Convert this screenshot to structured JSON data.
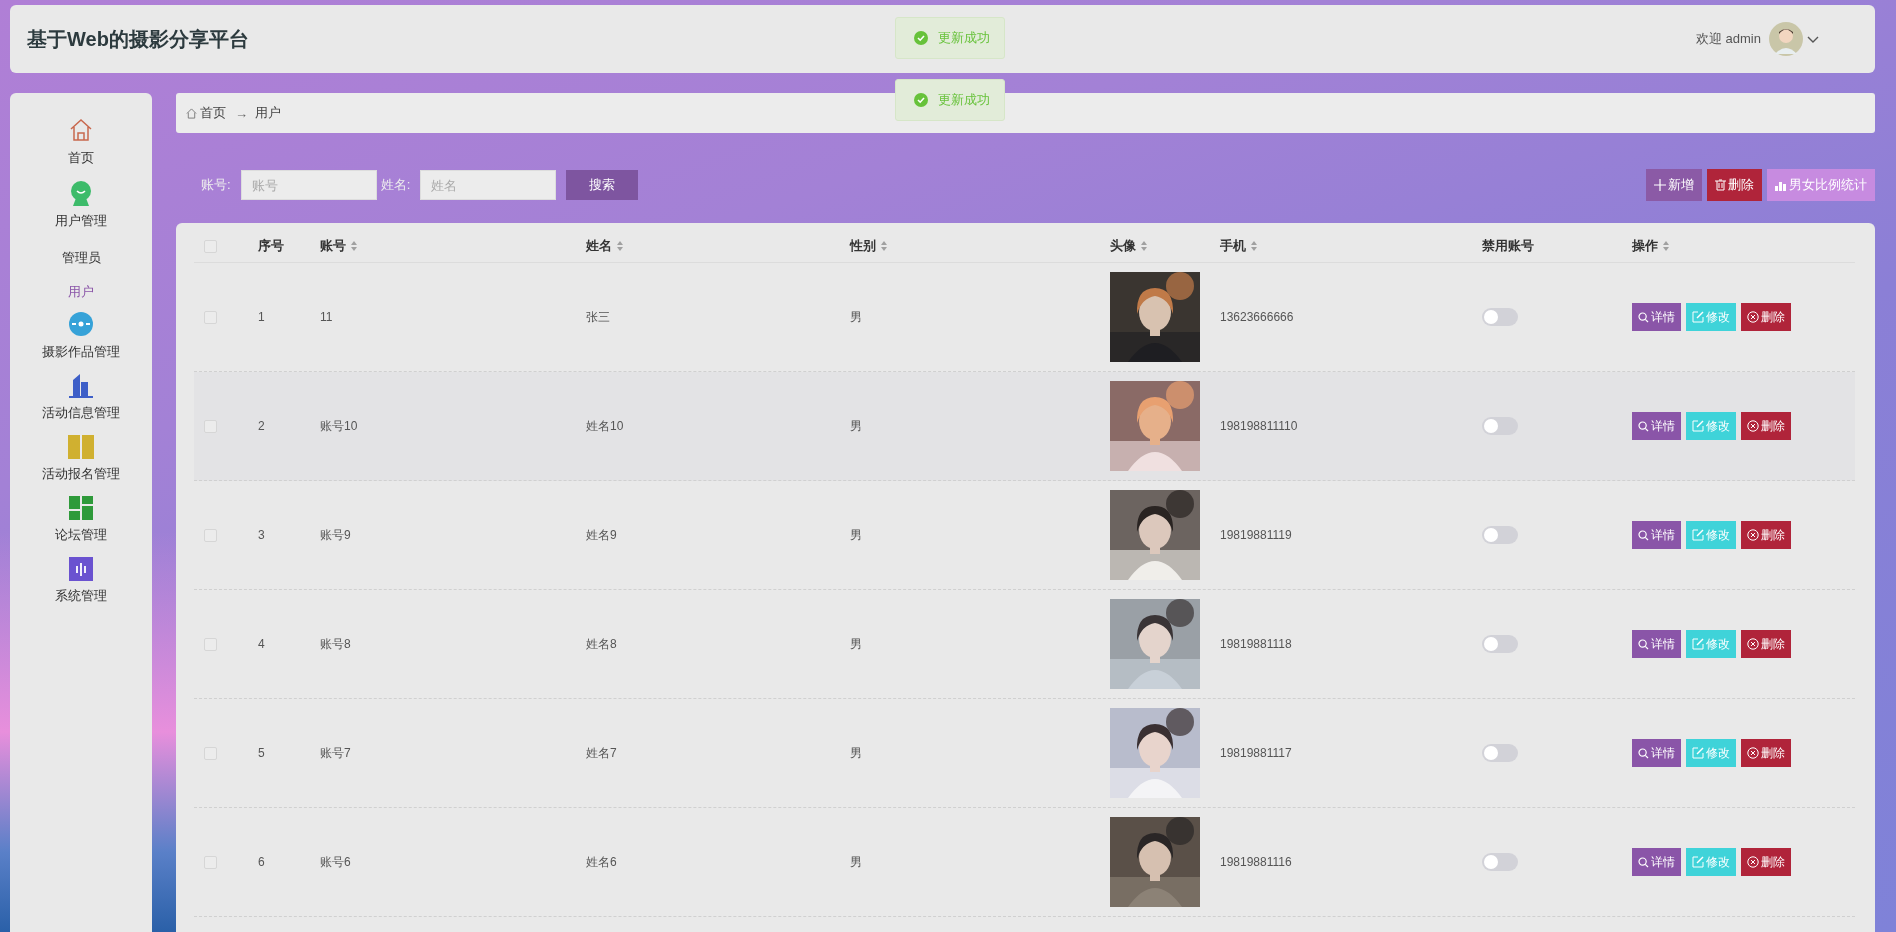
{
  "header": {
    "title": "基于Web的摄影分享平台",
    "welcome": "欢迎 admin"
  },
  "toasts": [
    {
      "text": "更新成功"
    },
    {
      "text": "更新成功"
    }
  ],
  "sidebar": {
    "items": [
      {
        "label": "首页"
      },
      {
        "label": "用户管理",
        "children": [
          {
            "label": "管理员",
            "selected": false
          },
          {
            "label": "用户",
            "selected": true
          }
        ]
      },
      {
        "label": "摄影作品管理"
      },
      {
        "label": "活动信息管理"
      },
      {
        "label": "活动报名管理"
      },
      {
        "label": "论坛管理"
      },
      {
        "label": "系统管理"
      }
    ]
  },
  "breadcrumb": {
    "items": [
      "首页",
      "用户"
    ],
    "separator": "→"
  },
  "search": {
    "fields": [
      {
        "label": "账号:",
        "placeholder": "账号"
      },
      {
        "label": "姓名:",
        "placeholder": "姓名"
      }
    ],
    "button": "搜索"
  },
  "toolbar": [
    {
      "kind": "add",
      "label": "新增"
    },
    {
      "kind": "delete",
      "label": "删除"
    },
    {
      "kind": "chart",
      "label": "男女比例统计"
    }
  ],
  "table": {
    "all_checked": false,
    "columns": [
      {
        "label": "序号",
        "sortable": false
      },
      {
        "label": "账号",
        "sortable": true
      },
      {
        "label": "姓名",
        "sortable": true
      },
      {
        "label": "性别",
        "sortable": true
      },
      {
        "label": "头像",
        "sortable": true
      },
      {
        "label": "手机",
        "sortable": true
      },
      {
        "label": "禁用账号",
        "sortable": false
      },
      {
        "label": "操作",
        "sortable": true
      }
    ],
    "rows": [
      {
        "index": "1",
        "account": "11",
        "name": "张三",
        "gender": "男",
        "phone": "13623666666",
        "disabled": false,
        "checked": false,
        "actions": [
          {
            "kind": "detail",
            "label": "详情"
          },
          {
            "kind": "edit",
            "label": "修改"
          },
          {
            "kind": "delete",
            "label": "删除"
          }
        ]
      },
      {
        "index": "2",
        "account": "账号10",
        "name": "姓名10",
        "gender": "男",
        "phone": "198198811110",
        "disabled": false,
        "checked": false,
        "actions": [
          {
            "kind": "detail",
            "label": "详情"
          },
          {
            "kind": "edit",
            "label": "修改"
          },
          {
            "kind": "delete",
            "label": "删除"
          }
        ]
      },
      {
        "index": "3",
        "account": "账号9",
        "name": "姓名9",
        "gender": "男",
        "phone": "19819881119",
        "disabled": false,
        "checked": false,
        "actions": [
          {
            "kind": "detail",
            "label": "详情"
          },
          {
            "kind": "edit",
            "label": "修改"
          },
          {
            "kind": "delete",
            "label": "删除"
          }
        ]
      },
      {
        "index": "4",
        "account": "账号8",
        "name": "姓名8",
        "gender": "男",
        "phone": "19819881118",
        "disabled": false,
        "checked": false,
        "actions": [
          {
            "kind": "detail",
            "label": "详情"
          },
          {
            "kind": "edit",
            "label": "修改"
          },
          {
            "kind": "delete",
            "label": "删除"
          }
        ]
      },
      {
        "index": "5",
        "account": "账号7",
        "name": "姓名7",
        "gender": "男",
        "phone": "19819881117",
        "disabled": false,
        "checked": false,
        "actions": [
          {
            "kind": "detail",
            "label": "详情"
          },
          {
            "kind": "edit",
            "label": "修改"
          },
          {
            "kind": "delete",
            "label": "删除"
          }
        ]
      },
      {
        "index": "6",
        "account": "账号6",
        "name": "姓名6",
        "gender": "男",
        "phone": "19819881116",
        "disabled": false,
        "checked": false,
        "actions": [
          {
            "kind": "detail",
            "label": "详情"
          },
          {
            "kind": "edit",
            "label": "修改"
          },
          {
            "kind": "delete",
            "label": "删除"
          }
        ]
      }
    ]
  }
}
